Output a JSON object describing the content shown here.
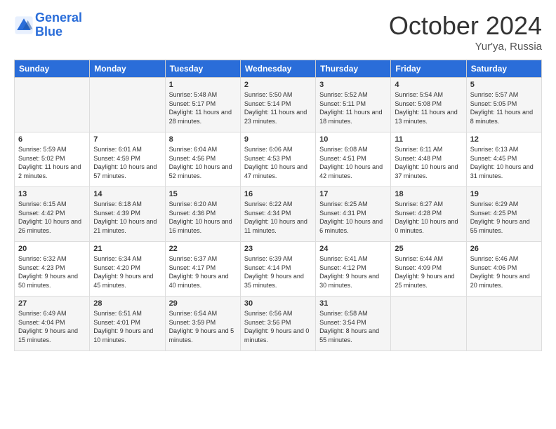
{
  "logo": {
    "line1": "General",
    "line2": "Blue"
  },
  "title": "October 2024",
  "location": "Yur'ya, Russia",
  "days_of_week": [
    "Sunday",
    "Monday",
    "Tuesday",
    "Wednesday",
    "Thursday",
    "Friday",
    "Saturday"
  ],
  "weeks": [
    [
      {
        "day": "",
        "info": ""
      },
      {
        "day": "",
        "info": ""
      },
      {
        "day": "1",
        "info": "Sunrise: 5:48 AM\nSunset: 5:17 PM\nDaylight: 11 hours and 28 minutes."
      },
      {
        "day": "2",
        "info": "Sunrise: 5:50 AM\nSunset: 5:14 PM\nDaylight: 11 hours and 23 minutes."
      },
      {
        "day": "3",
        "info": "Sunrise: 5:52 AM\nSunset: 5:11 PM\nDaylight: 11 hours and 18 minutes."
      },
      {
        "day": "4",
        "info": "Sunrise: 5:54 AM\nSunset: 5:08 PM\nDaylight: 11 hours and 13 minutes."
      },
      {
        "day": "5",
        "info": "Sunrise: 5:57 AM\nSunset: 5:05 PM\nDaylight: 11 hours and 8 minutes."
      }
    ],
    [
      {
        "day": "6",
        "info": "Sunrise: 5:59 AM\nSunset: 5:02 PM\nDaylight: 11 hours and 2 minutes."
      },
      {
        "day": "7",
        "info": "Sunrise: 6:01 AM\nSunset: 4:59 PM\nDaylight: 10 hours and 57 minutes."
      },
      {
        "day": "8",
        "info": "Sunrise: 6:04 AM\nSunset: 4:56 PM\nDaylight: 10 hours and 52 minutes."
      },
      {
        "day": "9",
        "info": "Sunrise: 6:06 AM\nSunset: 4:53 PM\nDaylight: 10 hours and 47 minutes."
      },
      {
        "day": "10",
        "info": "Sunrise: 6:08 AM\nSunset: 4:51 PM\nDaylight: 10 hours and 42 minutes."
      },
      {
        "day": "11",
        "info": "Sunrise: 6:11 AM\nSunset: 4:48 PM\nDaylight: 10 hours and 37 minutes."
      },
      {
        "day": "12",
        "info": "Sunrise: 6:13 AM\nSunset: 4:45 PM\nDaylight: 10 hours and 31 minutes."
      }
    ],
    [
      {
        "day": "13",
        "info": "Sunrise: 6:15 AM\nSunset: 4:42 PM\nDaylight: 10 hours and 26 minutes."
      },
      {
        "day": "14",
        "info": "Sunrise: 6:18 AM\nSunset: 4:39 PM\nDaylight: 10 hours and 21 minutes."
      },
      {
        "day": "15",
        "info": "Sunrise: 6:20 AM\nSunset: 4:36 PM\nDaylight: 10 hours and 16 minutes."
      },
      {
        "day": "16",
        "info": "Sunrise: 6:22 AM\nSunset: 4:34 PM\nDaylight: 10 hours and 11 minutes."
      },
      {
        "day": "17",
        "info": "Sunrise: 6:25 AM\nSunset: 4:31 PM\nDaylight: 10 hours and 6 minutes."
      },
      {
        "day": "18",
        "info": "Sunrise: 6:27 AM\nSunset: 4:28 PM\nDaylight: 10 hours and 0 minutes."
      },
      {
        "day": "19",
        "info": "Sunrise: 6:29 AM\nSunset: 4:25 PM\nDaylight: 9 hours and 55 minutes."
      }
    ],
    [
      {
        "day": "20",
        "info": "Sunrise: 6:32 AM\nSunset: 4:23 PM\nDaylight: 9 hours and 50 minutes."
      },
      {
        "day": "21",
        "info": "Sunrise: 6:34 AM\nSunset: 4:20 PM\nDaylight: 9 hours and 45 minutes."
      },
      {
        "day": "22",
        "info": "Sunrise: 6:37 AM\nSunset: 4:17 PM\nDaylight: 9 hours and 40 minutes."
      },
      {
        "day": "23",
        "info": "Sunrise: 6:39 AM\nSunset: 4:14 PM\nDaylight: 9 hours and 35 minutes."
      },
      {
        "day": "24",
        "info": "Sunrise: 6:41 AM\nSunset: 4:12 PM\nDaylight: 9 hours and 30 minutes."
      },
      {
        "day": "25",
        "info": "Sunrise: 6:44 AM\nSunset: 4:09 PM\nDaylight: 9 hours and 25 minutes."
      },
      {
        "day": "26",
        "info": "Sunrise: 6:46 AM\nSunset: 4:06 PM\nDaylight: 9 hours and 20 minutes."
      }
    ],
    [
      {
        "day": "27",
        "info": "Sunrise: 6:49 AM\nSunset: 4:04 PM\nDaylight: 9 hours and 15 minutes."
      },
      {
        "day": "28",
        "info": "Sunrise: 6:51 AM\nSunset: 4:01 PM\nDaylight: 9 hours and 10 minutes."
      },
      {
        "day": "29",
        "info": "Sunrise: 6:54 AM\nSunset: 3:59 PM\nDaylight: 9 hours and 5 minutes."
      },
      {
        "day": "30",
        "info": "Sunrise: 6:56 AM\nSunset: 3:56 PM\nDaylight: 9 hours and 0 minutes."
      },
      {
        "day": "31",
        "info": "Sunrise: 6:58 AM\nSunset: 3:54 PM\nDaylight: 8 hours and 55 minutes."
      },
      {
        "day": "",
        "info": ""
      },
      {
        "day": "",
        "info": ""
      }
    ]
  ]
}
